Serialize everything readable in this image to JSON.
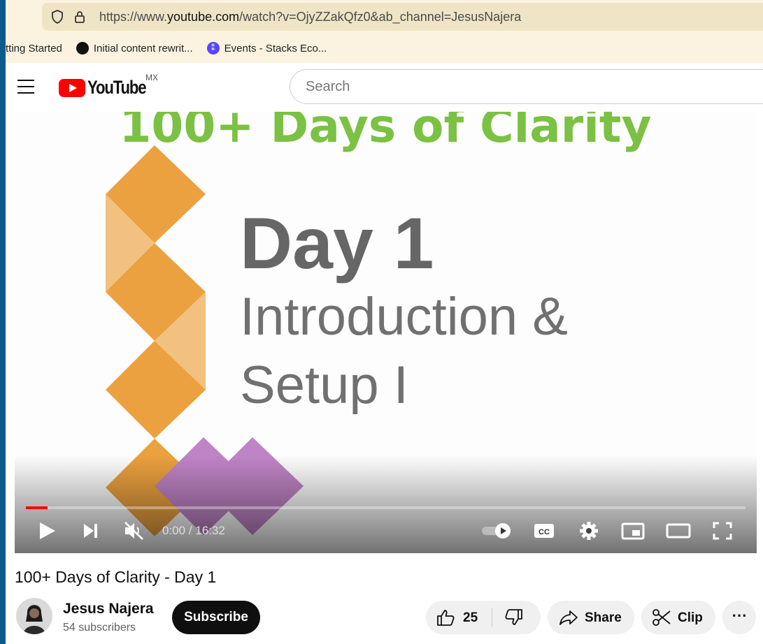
{
  "browser": {
    "url_prefix": "https://www.",
    "url_domain": "youtube.com",
    "url_path": "/watch?v=OjyZZakQfz0&ab_channel=JesusNajera",
    "bookmarks": [
      {
        "label": "tting Started"
      },
      {
        "label": "Initial content rewrit...",
        "icon": "github-icon"
      },
      {
        "label": "Events - Stacks Eco...",
        "icon": "stacks-icon"
      }
    ]
  },
  "masthead": {
    "logo_text": "YouTube",
    "region": "MX",
    "search_placeholder": "Search"
  },
  "video": {
    "frame_title": "100+ Days of Clarity",
    "frame_day": "Day 1",
    "frame_subtitle_line1": "Introduction &",
    "frame_subtitle_line2": "Setup I",
    "time_display": "0:00 / 16:32",
    "progress_fraction": 0.03,
    "colors": {
      "frame_title": "#7bc143",
      "orange": "#eba13f",
      "light_orange": "#f2c07f",
      "purple": "#bf84c5"
    }
  },
  "details": {
    "title": "100+ Days of Clarity - Day 1",
    "channel_name": "Jesus Najera",
    "subscribers": "54 subscribers",
    "subscribe_label": "Subscribe",
    "likes": "25",
    "share_label": "Share",
    "clip_label": "Clip",
    "more_label": "⋯"
  }
}
